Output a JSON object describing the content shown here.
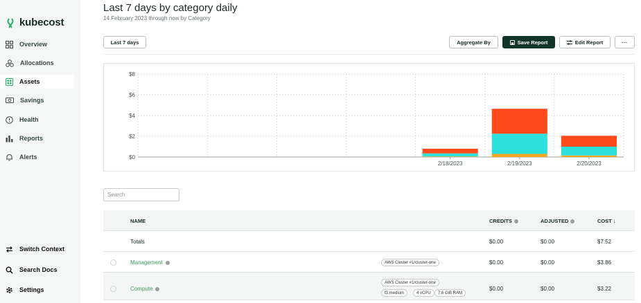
{
  "app": {
    "brand": "kubecost",
    "brand_color": "#29b26a"
  },
  "sidebar": {
    "items": [
      {
        "label": "Overview",
        "icon": "grid-icon",
        "active": false
      },
      {
        "label": "Allocations",
        "icon": "allocations-icon",
        "active": false
      },
      {
        "label": "Assets",
        "icon": "assets-icon",
        "active": true
      },
      {
        "label": "Savings",
        "icon": "savings-icon",
        "active": false
      },
      {
        "label": "Health",
        "icon": "health-icon",
        "active": false
      },
      {
        "label": "Reports",
        "icon": "reports-icon",
        "active": false
      },
      {
        "label": "Alerts",
        "icon": "bell-icon",
        "active": false
      }
    ],
    "bottom": [
      {
        "label": "Switch Context",
        "icon": "switch-icon"
      },
      {
        "label": "Search Docs",
        "icon": "search-icon"
      },
      {
        "label": "Settings",
        "icon": "gear-icon"
      }
    ]
  },
  "header": {
    "title": "Last 7 days by category daily",
    "subtitle": "14 February 2023 through now by Category"
  },
  "toolbar": {
    "date_range_label": "Last 7 days",
    "aggregate_label": "Aggregate By",
    "save_label": "Save Report",
    "edit_label": "Edit Report",
    "more_label": "···"
  },
  "chart_data": {
    "type": "bar",
    "stacked": true,
    "categories": [
      "",
      "",
      "",
      "",
      "2/18/2023",
      "2/19/2023",
      "2/20/2023"
    ],
    "y_ticks": [
      "$0",
      "$2",
      "$4",
      "$6",
      "$8"
    ],
    "ylim": [
      0,
      8
    ],
    "grid": true,
    "series": [
      {
        "color": "#f5a623",
        "values": [
          0,
          0,
          0,
          0,
          0.05,
          0.3,
          0.15
        ]
      },
      {
        "color": "#2de0dc",
        "values": [
          0,
          0,
          0,
          0,
          0.3,
          1.95,
          0.85
        ]
      },
      {
        "color": "#ff4a1c",
        "values": [
          0,
          0,
          0,
          0,
          0.45,
          2.4,
          1.05
        ]
      }
    ]
  },
  "search": {
    "placeholder": "Search"
  },
  "table": {
    "headers": {
      "name": "NAME",
      "credits": "CREDITS",
      "adjusted": "ADJUSTED",
      "cost": "COST ↓"
    },
    "totals": {
      "label": "Totals",
      "credits": "$0.00",
      "adjusted": "$0.00",
      "cost": "$7.52"
    },
    "rows": [
      {
        "name": "Management",
        "chips": [
          "AWS Cluster #1/cluster-one"
        ],
        "credits": "$0.00",
        "adjusted": "$0.00",
        "cost": "$3.86"
      },
      {
        "name": "Compute",
        "chips": [
          "AWS Cluster #1/cluster-one",
          "t3.medium",
          "4 vCPU",
          "7.6 GiB RAM"
        ],
        "credits": "$0.00",
        "adjusted": "$0.00",
        "cost": "$3.22"
      }
    ]
  }
}
